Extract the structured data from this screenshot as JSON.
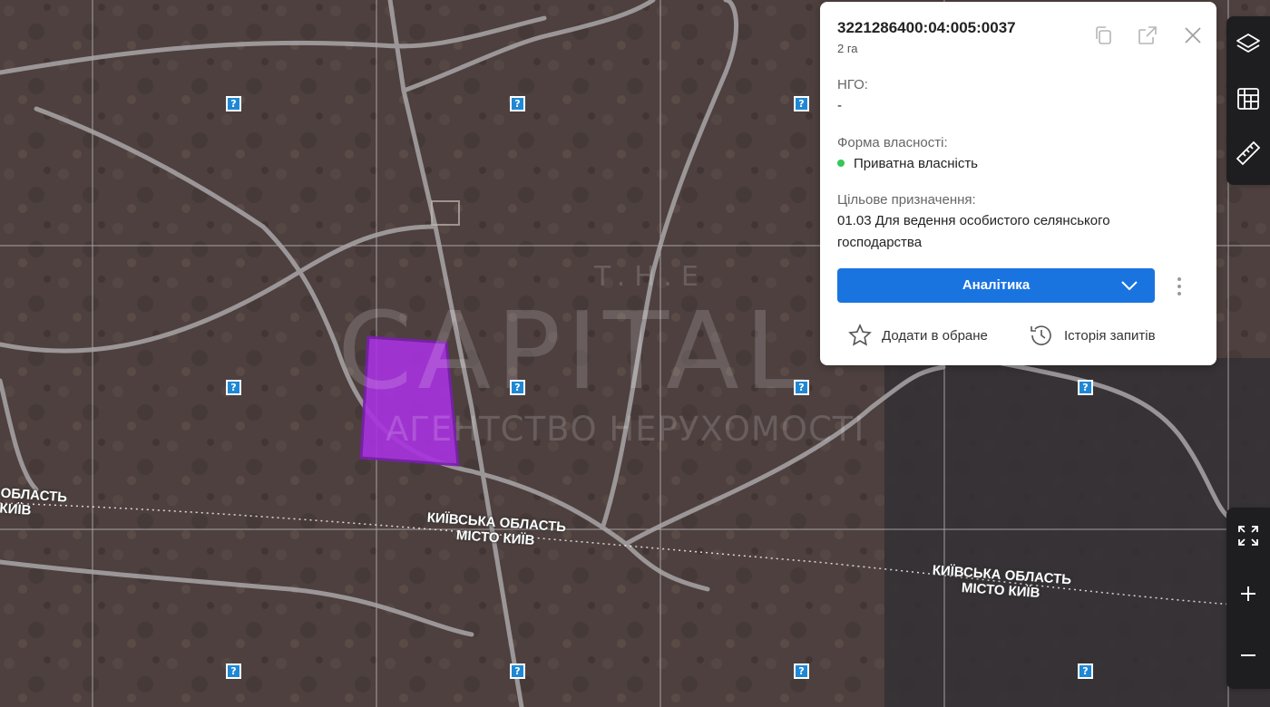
{
  "parcel": {
    "cadastral_number": "3221286400:04:005:0037",
    "area": "2 га",
    "ngo_label": "НГО:",
    "ngo_value": "-",
    "ownership_label": "Форма власності:",
    "ownership_value": "Приватна власність",
    "ownership_status_color": "#34c759",
    "purpose_label": "Цільове призначення:",
    "purpose_value": "01.03 Для ведення особистого селянського господарства"
  },
  "card_actions": {
    "analytics_label": "Аналітика",
    "favorite_label": "Додати в обране",
    "history_label": "Історія запитів",
    "copy_icon": "copy-icon",
    "open_icon": "external-link-icon",
    "close_icon": "close-icon"
  },
  "map": {
    "marker_glyph": "?",
    "boundary_labels": [
      {
        "line1": "КИЇВСЬКА ОБЛАСТЬ",
        "line2": "МІСТО КИЇВ"
      },
      {
        "line1": "КИЇВСЬКА ОБЛАСТЬ",
        "line2": "МІСТО КИЇВ"
      }
    ],
    "edge_label": {
      "line1": "ОБЛАСТЬ",
      "line2": "КИЇВ"
    },
    "watermark": {
      "top": "T.H.E",
      "main": "CAPITAL",
      "sub": "АГЕНТСТВО НЕРУХОМОСТІ"
    },
    "parcel_color": "#a832e0"
  },
  "toolbar": {
    "layers_icon": "layers-icon",
    "cadastre_icon": "cadastre-icon",
    "ruler_icon": "ruler-icon",
    "fullscreen_icon": "fullscreen-icon",
    "zoom_in_icon": "zoom-in-icon",
    "zoom_out_icon": "zoom-out-icon"
  }
}
